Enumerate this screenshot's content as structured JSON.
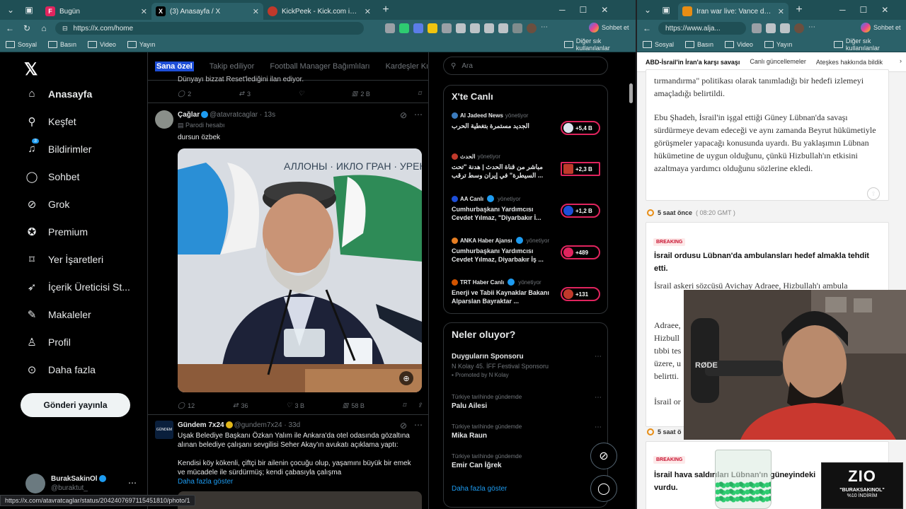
{
  "left_window": {
    "tabs": [
      {
        "label": "Bugün",
        "icon_color": "#e0245e",
        "icon_letter": "F"
      },
      {
        "label": "(3) Anasayfa / X",
        "icon_color": "#000000",
        "icon_letter": "X"
      },
      {
        "label": "KickPeek - Kick.com için Gerçek Za",
        "icon_color": "#c0392b",
        "icon_letter": ""
      }
    ],
    "url": "https://x.com/home",
    "profile_button": "Sohbet et",
    "bookmarks": [
      "Sosyal",
      "Basın",
      "Video",
      "Yayın"
    ],
    "other_bookmarks": "Diğer sık kullanılanlar",
    "status_url": "https://x.com/atavratcaglar/status/2042407697115451810/photo/1"
  },
  "x": {
    "nav": [
      {
        "label": "Anasayfa",
        "icon": "home-icon"
      },
      {
        "label": "Keşfet",
        "icon": "search-icon"
      },
      {
        "label": "Bildirimler",
        "icon": "bell-icon",
        "badge": "3"
      },
      {
        "label": "Sohbet",
        "icon": "chat-icon"
      },
      {
        "label": "Grok",
        "icon": "grok-icon"
      },
      {
        "label": "Premium",
        "icon": "premium-icon"
      },
      {
        "label": "Yer İşaretleri",
        "icon": "bookmark-icon"
      },
      {
        "label": "İçerik Üreticisi St...",
        "icon": "rocket-icon"
      },
      {
        "label": "Makaleler",
        "icon": "article-icon"
      },
      {
        "label": "Profil",
        "icon": "person-icon"
      },
      {
        "label": "Daha fazla",
        "icon": "more-circle-icon"
      }
    ],
    "post_button": "Gönderi yayınla",
    "profile": {
      "name": "BurakSakinOl",
      "handle": "@buraktut_"
    },
    "feed_tabs": [
      "Sana özel",
      "Takip ediliyor",
      "Football Manager Bağımlıları",
      "Kardeşler Kıraath"
    ],
    "prev_post": {
      "text": "Dünyayı bizzat Reset'lediğini ilan ediyor.",
      "replies": "2",
      "reposts": "3",
      "likes": "",
      "views": "2 B"
    },
    "post1": {
      "name": "Çağlar",
      "handle": "@atavratcaglar",
      "time": "13s",
      "label": "Parodi hesabı",
      "text": "dursun özbek",
      "replies": "12",
      "reposts": "36",
      "likes": "3 B",
      "views": "58 B",
      "banner_text": "АЛЛОНЫ · ИКЛО ГРАН · УРЕКС · ФОРМ"
    },
    "post2": {
      "name": "Gündem 7x24",
      "handle": "@gundem7x24",
      "time": "33d",
      "avatar_text": "GÜNDEM 7x24",
      "text1": "Uşak Belediye Başkanı Özkan Yalım ile Ankara'da otel odasında gözaltına alınan belediye çalışanı sevgilisi Seher Akay'ın avukatı açıklama yaptı:",
      "text2": "Kendisi köy kökenli, çiftçi bir ailenin çocuğu olup, yaşamını büyük bir emek ve mücadele ile sürdürmüş; kendi çabasıyla çalışma",
      "more": "Daha fazla göster"
    },
    "search_placeholder": "Ara",
    "live": {
      "title": "X'te Canlı",
      "items": [
        {
          "source": "Al Jadeed News",
          "status": "yönetiyor",
          "text": "الجديد مستمرة بتغطية الحرب",
          "count": "+5,4 B"
        },
        {
          "source": "الحدث",
          "status": "yönetiyor",
          "text": "مباشر من قناة الحدث | هدنة \"تحت السيطرة\" في إيران وسط ترقب ...",
          "count": "+2,3 B"
        },
        {
          "source": "AA Canlı",
          "status": "yönetiyor",
          "text": "Cumhurbaşkanı Yardımcısı Cevdet Yılmaz, \"Diyarbakır İ...",
          "count": "+1,2 B"
        },
        {
          "source": "ANKA Haber Ajansı",
          "status": "yönetiyor",
          "text": "Cumhurbaşkanı Yardımcısı Cevdet Yılmaz, Diyarbakır İş ...",
          "count": "+489"
        },
        {
          "source": "TRT Haber Canlı",
          "status": "yönetiyor",
          "text": "Enerji ve Tabii Kaynaklar Bakanı Alparslan Bayraktar ...",
          "count": "+131"
        }
      ]
    },
    "trends": {
      "title": "Neler oluyor?",
      "items": [
        {
          "context": "",
          "name": "Duyguların Sponsoru",
          "sub": "N Kolay 45. İFF Festival Sponsoru",
          "promo": "Promoted by N Kolay"
        },
        {
          "context": "Türkiye tarihinde gündemde",
          "name": "Palu Ailesi"
        },
        {
          "context": "Türkiye tarihinde gündemde",
          "name": "Mika Raun"
        },
        {
          "context": "Türkiye tarihinde gündemde",
          "name": "Emir Can İğrek"
        }
      ],
      "more": "Daha fazla göster"
    }
  },
  "right_window": {
    "tab": "Iran war live: Vance departs for tal",
    "url": "https://www.alja...",
    "profile_button": "Sohbet et",
    "bookmarks": [
      "Sosyal",
      "Basın",
      "Video",
      "Yayın"
    ],
    "other_bookmarks": "Diğer sık kullanılanlar",
    "page_tabs": [
      "ABD-İsrail'in İran'a karşı savaşı",
      "Canlı güncellemeler",
      "Ateşkes hakkında bildik"
    ],
    "para1": "tırmandırma\" politikası olarak tanımladığı bir hedefi izlemeyi amaçladığı belirtildi.",
    "para2": "Ebu Şhadeh, İsrail'in işgal ettiği Güney Lübnan'da savaşı sürdürmeye devam edeceği ve aynı zamanda Beyrut hükümetiyle görüşmeler yapacağı konusunda uyardı. Bu yaklaşımın Lübnan hükümetine de uygun olduğunu, çünkü Hizbullah'ın etkisini azaltmaya yardımcı olduğunu sözlerine ekledi.",
    "time1": "5 saat önce",
    "time1_gmt": "( 08:20 GMT )",
    "breaking": "BREAKING",
    "head1": "İsrail ordusu Lübnan'da ambulansları hedef almakla tehdit etti.",
    "body1": "İsrail askeri sözcüsü Avichay Adraee, Hizbullah'ı ambula",
    "body1b": "Adraee,",
    "body1c": "Hizbull",
    "body1d": "tıbbi tes",
    "body1e": "üzere, u",
    "body1f": "belirtti.",
    "body1g": "İsrail or",
    "time2": "5 saat ö",
    "head2": "İsrail hava saldırıları Lübnan'ın güneyindeki vurdu."
  },
  "overlay": {
    "mic_brand": "RØDE",
    "promo_logo": "ZIO",
    "promo_code": "\"BURAKSAKINOL\"",
    "promo_discount": "%10 İNDİRİM"
  },
  "colors": {
    "x_blue": "#1d9bf0",
    "live_red": "#e0245e",
    "edge_teal": "#2b6169",
    "aj_orange": "#e88d14",
    "breaking_red": "#c8102e"
  }
}
